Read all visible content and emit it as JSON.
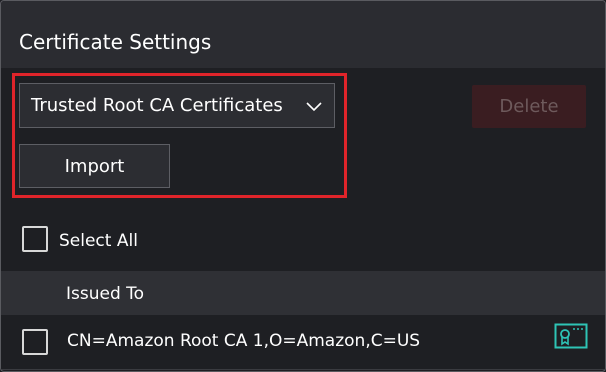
{
  "panel": {
    "title": "Certificate Settings"
  },
  "store_select": {
    "selected": "Trusted Root CA Certificates",
    "icon": "chevron-down-icon"
  },
  "actions": {
    "import_label": "Import",
    "delete_label": "Delete",
    "delete_enabled": false
  },
  "select_all": {
    "label": "Select All",
    "checked": false
  },
  "table": {
    "columns": [
      "Issued To"
    ],
    "rows": [
      {
        "issued_to": "CN=Amazon Root CA 1,O=Amazon,C=US",
        "checked": false,
        "icon": "certificate-icon"
      }
    ]
  },
  "colors": {
    "highlight": "#e0242a",
    "accent_teal": "#2ec4b6",
    "delete_disabled_bg": "#3a1d21"
  }
}
